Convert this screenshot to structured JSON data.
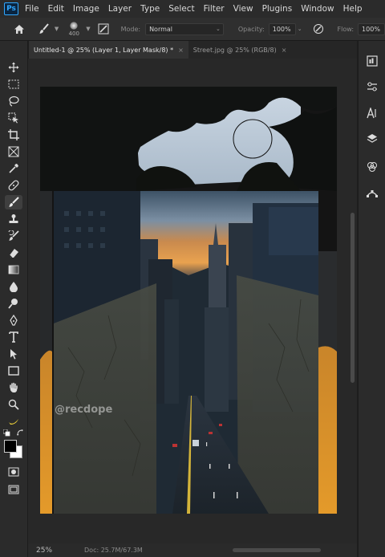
{
  "menubar": {
    "app_icon": "Ps",
    "items": [
      "File",
      "Edit",
      "Image",
      "Layer",
      "Type",
      "Select",
      "Filter",
      "View",
      "Plugins",
      "Window",
      "Help"
    ]
  },
  "options": {
    "brush_size": "400",
    "mode_label": "Mode:",
    "mode_value": "Normal",
    "opacity_label": "Opacity:",
    "opacity_value": "100%",
    "flow_label": "Flow:",
    "flow_value": "100%"
  },
  "tabs": [
    {
      "label": "Untitled-1 @ 25% (Layer 1, Layer Mask/8) *",
      "active": true
    },
    {
      "label": "Street.jpg @ 25% (RGB/8)",
      "active": false
    }
  ],
  "canvas": {
    "watermark": "@recdope"
  },
  "status": {
    "zoom": "25%",
    "doc_size": "Doc: 25.7M/67.3M"
  },
  "colors": {
    "accent": "#31a8ff",
    "road_texture": "#e49a2a",
    "sky": "#b7c9d8",
    "panel": "#2b2b2b"
  },
  "tools": [
    "move-icon",
    "marquee-icon",
    "lasso-icon",
    "object-select-icon",
    "crop-icon",
    "frame-icon",
    "eyedropper-icon",
    "healing-icon",
    "brush-icon",
    "stamp-icon",
    "history-brush-icon",
    "eraser-icon",
    "gradient-icon",
    "blur-icon",
    "dodge-icon",
    "pen-icon",
    "type-icon",
    "path-select-icon",
    "rectangle-icon",
    "hand-icon",
    "zoom-icon",
    "banana-icon"
  ],
  "right_panels": [
    "libraries-icon",
    "adjustments-icon",
    "character-icon",
    "layers-icon",
    "channels-icon",
    "paths-icon"
  ]
}
